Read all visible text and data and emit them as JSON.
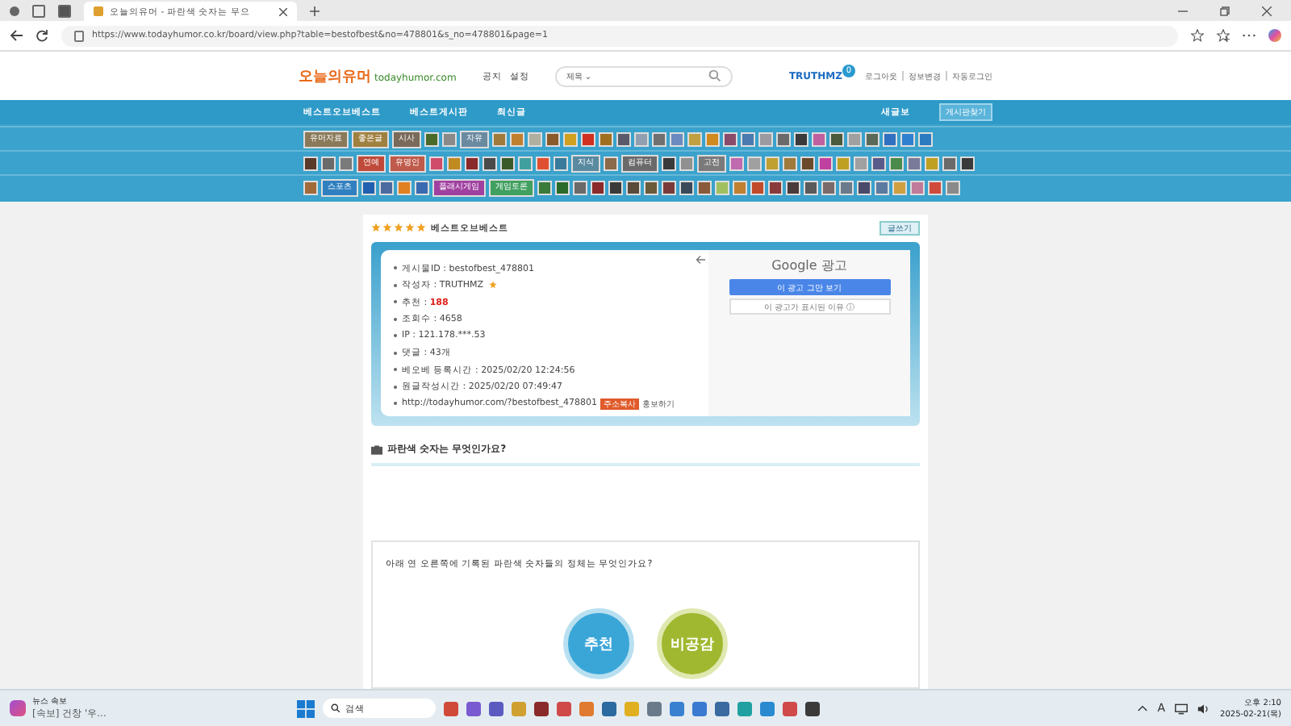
{
  "browser": {
    "tab_title": "오늘의유머 - 파란색 숫자는 무으",
    "url": "https://www.todayhumor.co.kr/board/view.php?table=bestofbest&no=478801&s_no=478801&page=1"
  },
  "header": {
    "logo_main": "오늘의유머",
    "logo_domain": "todayhumor.com",
    "links": [
      "공지",
      "설정"
    ],
    "search_scope": "제목 ⌄",
    "user": "TRUTHMZ",
    "user_badge": "0",
    "account_links": [
      "로그아웃",
      "정보변경",
      "자동로그인"
    ]
  },
  "nav": {
    "items": [
      "베스트오브베스트",
      "베스트게시판",
      "최신글"
    ],
    "new_label": "새글보",
    "find_button": "게시판찾기"
  },
  "board_rows": [
    [
      {
        "label": "유머자료",
        "color": "#8a7a5a"
      },
      {
        "label": "좋은글",
        "color": "#a08040"
      },
      {
        "label": "시사",
        "color": "#7a6a5a"
      },
      {
        "color": "#4a6a2a"
      },
      {
        "color": "#8a8a8a"
      },
      {
        "label": "자유",
        "color": "#6a8aa0"
      },
      {
        "color": "#a07a3a"
      },
      {
        "color": "#c08030"
      },
      {
        "color": "#b0b0a0"
      },
      {
        "color": "#8a5a2a"
      },
      {
        "color": "#d0a020"
      },
      {
        "color": "#d03020"
      },
      {
        "color": "#a07020"
      },
      {
        "color": "#5a5a6a"
      },
      {
        "color": "#90a0b0"
      },
      {
        "color": "#707070"
      },
      {
        "color": "#6a8ac0"
      },
      {
        "color": "#c0a040"
      },
      {
        "color": "#d08a20"
      },
      {
        "color": "#8a4a6a"
      },
      {
        "color": "#4a7ab0"
      },
      {
        "color": "#9a9aa0"
      },
      {
        "color": "#6a6a6a"
      },
      {
        "color": "#3a3a3a"
      },
      {
        "color": "#c060a0"
      },
      {
        "color": "#4a5a3a"
      },
      {
        "color": "#a0a0a0"
      },
      {
        "color": "#5a6a5a"
      },
      {
        "color": "#3070c0"
      },
      {
        "color": "#3080d0"
      },
      {
        "color": "#2a7ac0"
      }
    ],
    [
      {
        "color": "#5a3a2a"
      },
      {
        "color": "#6a6a6a"
      },
      {
        "color": "#7a7a7a"
      },
      {
        "label": "연예",
        "color": "#c04a3a"
      },
      {
        "label": "유명인",
        "color": "#c05a4a"
      },
      {
        "color": "#d04a6a"
      },
      {
        "color": "#c08a20"
      },
      {
        "color": "#8a2a2a"
      },
      {
        "color": "#4a4a4a"
      },
      {
        "color": "#3a5a2a"
      },
      {
        "color": "#40a0a0"
      },
      {
        "color": "#e05030"
      },
      {
        "color": "#3a7a9a"
      },
      {
        "label": "지식",
        "color": "#5a8aa0"
      },
      {
        "color": "#8a6a4a"
      },
      {
        "label": "컴퓨터",
        "color": "#6a6a6a"
      },
      {
        "color": "#3a3a3a"
      },
      {
        "color": "#909090"
      },
      {
        "label": "고전",
        "color": "#7a7a7a"
      },
      {
        "color": "#c06ab0"
      },
      {
        "color": "#a0a0a0"
      },
      {
        "color": "#c0a030"
      },
      {
        "color": "#a07a3a"
      },
      {
        "color": "#6a4a2a"
      },
      {
        "color": "#c040a0"
      },
      {
        "color": "#c0a020"
      },
      {
        "color": "#a0a0a0"
      },
      {
        "color": "#5a5a8a"
      },
      {
        "color": "#4a8a4a"
      },
      {
        "color": "#7a7a9a"
      },
      {
        "color": "#c0a020"
      },
      {
        "color": "#6a6a6a"
      },
      {
        "color": "#3a3a3a"
      }
    ],
    [
      {
        "color": "#a06a3a"
      },
      {
        "label": "스포츠",
        "color": "#3080c0"
      },
      {
        "color": "#2060b0"
      },
      {
        "color": "#4a6aa0"
      },
      {
        "color": "#e08020"
      },
      {
        "color": "#3a6ab0"
      },
      {
        "label": "플래시게임",
        "color": "#a040a0"
      },
      {
        "label": "게임토론",
        "color": "#40a060"
      },
      {
        "color": "#3a7a3a"
      },
      {
        "color": "#2a6a2a"
      },
      {
        "color": "#6a6a6a"
      },
      {
        "color": "#8a2a2a"
      },
      {
        "color": "#3a3a3a"
      },
      {
        "color": "#5a4a3a"
      },
      {
        "color": "#6a5a3a"
      },
      {
        "color": "#7a3a3a"
      },
      {
        "color": "#3a4a5a"
      },
      {
        "color": "#8a5a3a"
      },
      {
        "color": "#a0c060"
      },
      {
        "color": "#c08030"
      },
      {
        "color": "#c04a2a"
      },
      {
        "color": "#8a3a3a"
      },
      {
        "color": "#4a3a3a"
      },
      {
        "color": "#5a5a5a"
      },
      {
        "color": "#7a6a6a"
      },
      {
        "color": "#6a7a8a"
      },
      {
        "color": "#4a4a6a"
      },
      {
        "color": "#5a7aa0"
      },
      {
        "color": "#d0a040"
      },
      {
        "color": "#c07a9a"
      },
      {
        "color": "#d04a3a"
      },
      {
        "color": "#8a8a8a"
      }
    ]
  ],
  "post": {
    "stars": 5,
    "board": "베스트오브베스트",
    "write_button": "글쓰기",
    "info": [
      {
        "text": "게시물ID : bestofbest_478801",
        "kind": "plain"
      },
      {
        "text": "작성자 : TRUTHMZ",
        "kind": "author"
      },
      {
        "text": "추천 : **188**",
        "kind": "plain"
      },
      {
        "text": "조회수 : 4658",
        "kind": "plain"
      },
      {
        "text": "IP : 121.178.***.53",
        "kind": "plain"
      },
      {
        "text": "댓글 : 43개",
        "kind": "plain"
      },
      {
        "text": "베오베 등록시간 : 2025/02/20 12:24:56",
        "kind": "plain"
      },
      {
        "text": "원글작성시간 : 2025/02/20 07:49:47",
        "kind": "plain"
      },
      {
        "text": "http://todayhumor.com/?bestofbest_478801",
        "kind": "url",
        "badge": "주소복사",
        "extra": "홍보하기"
      }
    ],
    "ad": {
      "title": "Google 광고",
      "stop_button": "이 광고 그만 보기",
      "why_button": "이 광고가 표시된 이유 ⓘ"
    },
    "title": "파란색 숫자는 무엇인가요?",
    "body": "아래 연 오른쪽에 기록된 파란색 숫자들의 정체는 무엇인가요?",
    "buttons": [
      {
        "label": "추천",
        "kind": "recommend"
      },
      {
        "label": "비공감",
        "kind": "dislike"
      }
    ]
  },
  "taskbar": {
    "news_title": "뉴스 속보",
    "news_text": "[속보] 건창 '우...",
    "search": "검색",
    "apps": [
      {
        "color": "#d04a3a"
      },
      {
        "color": "#7a5ad0"
      },
      {
        "color": "#5a5ac0"
      },
      {
        "color": "#d0a030"
      },
      {
        "color": "#8a2a2a"
      },
      {
        "color": "#d04a4a"
      },
      {
        "color": "#e07a30"
      },
      {
        "color": "#2a6aa0"
      },
      {
        "color": "#e0b020"
      },
      {
        "color": "#6a7a8a"
      },
      {
        "color": "#3a80d0"
      },
      {
        "color": "#3a7ad0"
      },
      {
        "color": "#3a6aa0"
      },
      {
        "color": "#20a0a0"
      },
      {
        "color": "#2a8ad0"
      },
      {
        "color": "#d04a4a"
      },
      {
        "color": "#3a3a3a"
      }
    ],
    "ime": "A",
    "time": "오후 2:10",
    "date": "2025-02-21(목)"
  }
}
